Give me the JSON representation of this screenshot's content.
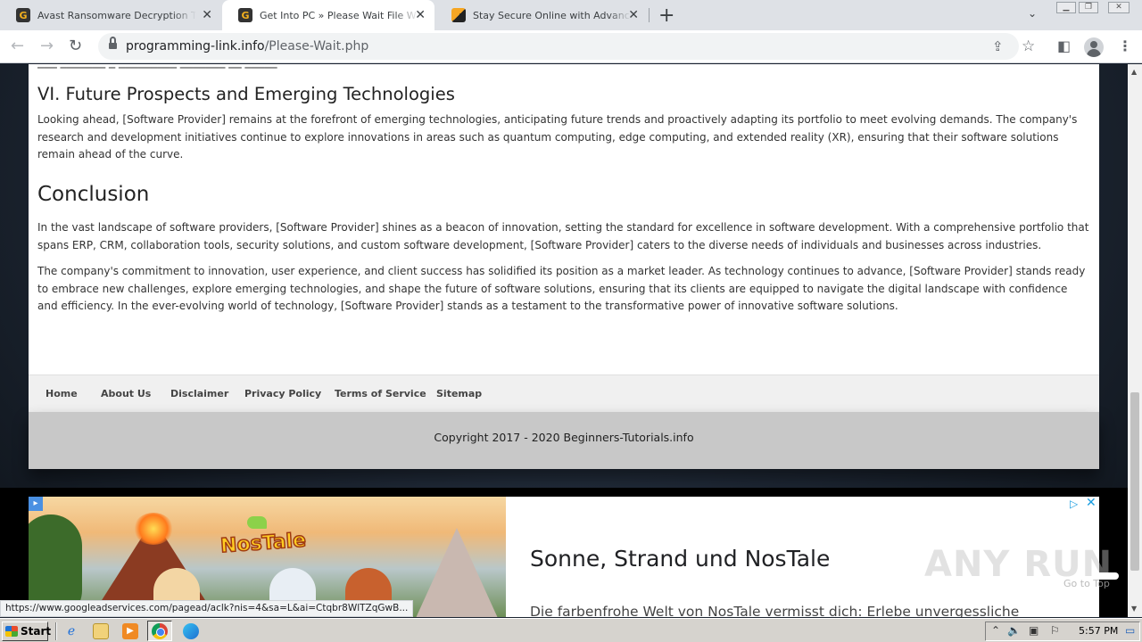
{
  "browser": {
    "tabs": [
      {
        "title": "Avast Ransomware Decryption Tools",
        "active": false,
        "favicon": "g-favicon"
      },
      {
        "title": "Get Into PC » Please Wait File Will St",
        "active": true,
        "favicon": "g-favicon"
      },
      {
        "title": "Stay Secure Online with Advanced A",
        "active": false,
        "favicon": "shield-favicon"
      }
    ],
    "url_domain": "programming-link.info",
    "url_path": "/Please-Wait.php"
  },
  "article": {
    "section_heading": "VI. Future Prospects and Emerging Technologies",
    "section_paragraph": "Looking ahead, [Software Provider] remains at the forefront of emerging technologies, anticipating future trends and proactively adapting its portfolio to meet evolving demands. The company's research and development initiatives continue to explore innovations in areas such as quantum computing, edge computing, and extended reality (XR), ensuring that their software solutions remain ahead of the curve.",
    "conclusion_heading": "Conclusion",
    "conclusion_p1": "In the vast landscape of software providers, [Software Provider] shines as a beacon of innovation, setting the standard for excellence in software development. With a comprehensive portfolio that spans ERP, CRM, collaboration tools, security solutions, and custom software development, [Software Provider] caters to the diverse needs of individuals and businesses across industries.",
    "conclusion_p2": "The company's commitment to innovation, user experience, and client success has solidified its position as a market leader. As technology continues to advance, [Software Provider] stands ready to embrace new challenges, explore emerging technologies, and shape the future of software solutions, ensuring that its clients are equipped to navigate the digital landscape with confidence and efficiency. In the ever-evolving world of technology, [Software Provider] stands as a testament to the transformative power of innovative software solutions."
  },
  "footer": {
    "links": [
      "Home",
      "About Us",
      "Disclaimer",
      "Privacy Policy",
      "Terms of Service",
      "Sitemap"
    ],
    "copyright": "Copyright 2017 - 2020 Beginners-Tutorials.info"
  },
  "ad": {
    "logo_text": "NosTale",
    "headline": "Sonne, Strand und NosTale",
    "description": "Die farbenfrohe Welt von NosTale vermisst dich: Erlebe unvergessliche"
  },
  "overlay": {
    "go_to_top": "Go to Top",
    "watermark": "ANY RUN"
  },
  "status_bar": {
    "link_url": "https://www.googleadservices.com/pagead/aclk?nis=4&sa=L&ai=Ctqbr8WlTZqGwB..."
  },
  "taskbar": {
    "start_label": "Start",
    "clock": "5:57 PM"
  }
}
